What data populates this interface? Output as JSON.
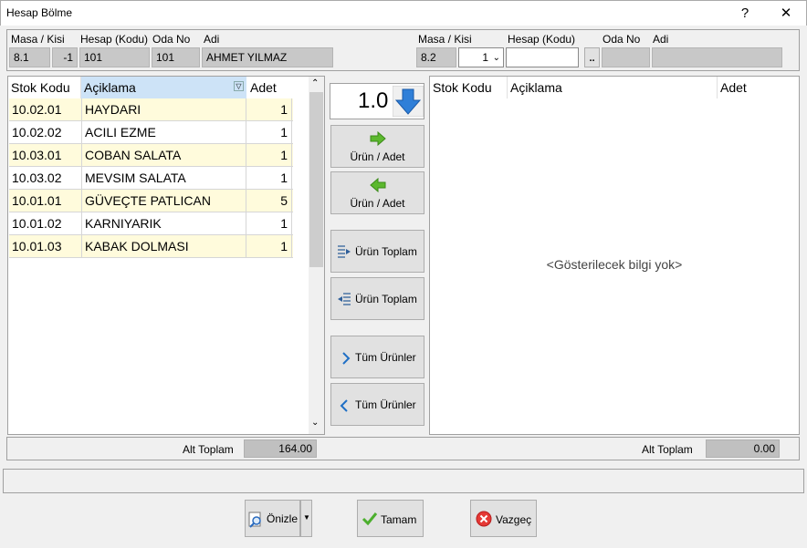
{
  "window": {
    "title": "Hesap Bölme",
    "help": "?",
    "close": "✕"
  },
  "left_header": {
    "labels": {
      "masa_kisi": "Masa / Kisi",
      "hesap_kodu": "Hesap (Kodu)",
      "oda_no": "Oda No",
      "adi": "Adi"
    },
    "values": {
      "masa": "8.1",
      "kisi": "-1",
      "hesap_kodu": "101",
      "oda_no": "101",
      "adi": "AHMET YILMAZ"
    }
  },
  "right_header": {
    "labels": {
      "masa_kisi": "Masa / Kisi",
      "hesap_kodu": "Hesap (Kodu)",
      "oda_no": "Oda No",
      "adi": "Adi"
    },
    "values": {
      "masa": "8.2",
      "kisi": "1",
      "hesap_kodu": "",
      "lookup": "..",
      "oda_no": "",
      "adi": ""
    }
  },
  "left_grid": {
    "columns": [
      "Stok Kodu",
      "Açiklama",
      "Adet"
    ],
    "rows": [
      {
        "kod": "10.02.01",
        "aciklama": "HAYDARI",
        "adet": "1"
      },
      {
        "kod": "10.02.02",
        "aciklama": "ACILI EZME",
        "adet": "1"
      },
      {
        "kod": "10.03.01",
        "aciklama": "COBAN SALATA",
        "adet": "1"
      },
      {
        "kod": "10.03.02",
        "aciklama": "MEVSIM SALATA",
        "adet": "1"
      },
      {
        "kod": "10.01.01",
        "aciklama": "GÜVEÇTE PATLICAN",
        "adet": "5"
      },
      {
        "kod": "10.01.02",
        "aciklama": "KARNIYARIK",
        "adet": "1"
      },
      {
        "kod": "10.01.03",
        "aciklama": "KABAK DOLMASI",
        "adet": "1"
      }
    ]
  },
  "right_grid": {
    "columns": [
      "Stok Kodu",
      "Açiklama",
      "Adet"
    ],
    "empty_text": "<Gösterilecek bilgi yok>"
  },
  "middle": {
    "quantity": "1.0",
    "btn_urun_adet_right": "Ürün / Adet",
    "btn_urun_adet_left": "Ürün / Adet",
    "btn_urun_toplam_right": "Ürün Toplam",
    "btn_urun_toplam_left": "Ürün Toplam",
    "btn_tum_urunler_right": "Tüm Ürünler",
    "btn_tum_urunler_left": "Tüm Ürünler"
  },
  "totals": {
    "left_label": "Alt Toplam",
    "left_value": "164.00",
    "right_label": "Alt Toplam",
    "right_value": "0.00"
  },
  "footer": {
    "onizle": "Önizle",
    "tamam": "Tamam",
    "vazgec": "Vazgeç"
  },
  "colors": {
    "arrow_green": "#5cb82e",
    "arrow_blue": "#2f7fd8",
    "row_alt": "#fffbdc",
    "header_selected": "#cde3f7"
  }
}
